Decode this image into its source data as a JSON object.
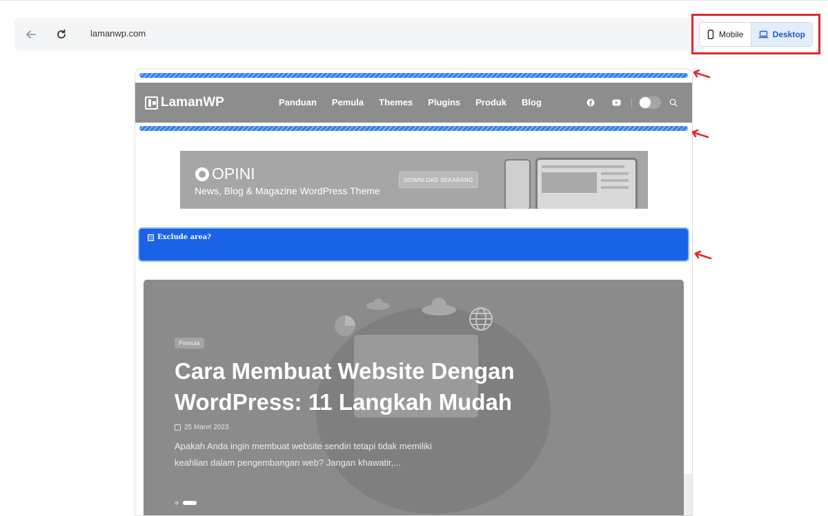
{
  "browser": {
    "url": "lamanwp.com"
  },
  "device_toggle": {
    "mobile_label": "Mobile",
    "desktop_label": "Desktop",
    "selected": "Desktop"
  },
  "site": {
    "logo_text": "LamanWP",
    "menu": [
      "Panduan",
      "Pemula",
      "Themes",
      "Plugins",
      "Produk",
      "Blog"
    ]
  },
  "banner": {
    "brand": "OPINI",
    "tagline": "News, Blog & Magazine WordPress Theme",
    "button": "DOWNLOAD SEKARANG"
  },
  "exclude": {
    "label": "Exclude area?"
  },
  "hero": {
    "category": "Pemula",
    "title": "Cara Membuat Website Dengan WordPress: 11 Langkah Mudah",
    "date": "25 Maret 2023",
    "excerpt": "Apakah Anda ingin membuat website sendiri tetapi tidak memiliki keahlian dalam pengembangan web? Jangan khawatir,..."
  },
  "colors": {
    "annotation_red": "#e0262c",
    "exclude_blue": "#1a63e6",
    "active_toggle": "#e3edfb"
  }
}
